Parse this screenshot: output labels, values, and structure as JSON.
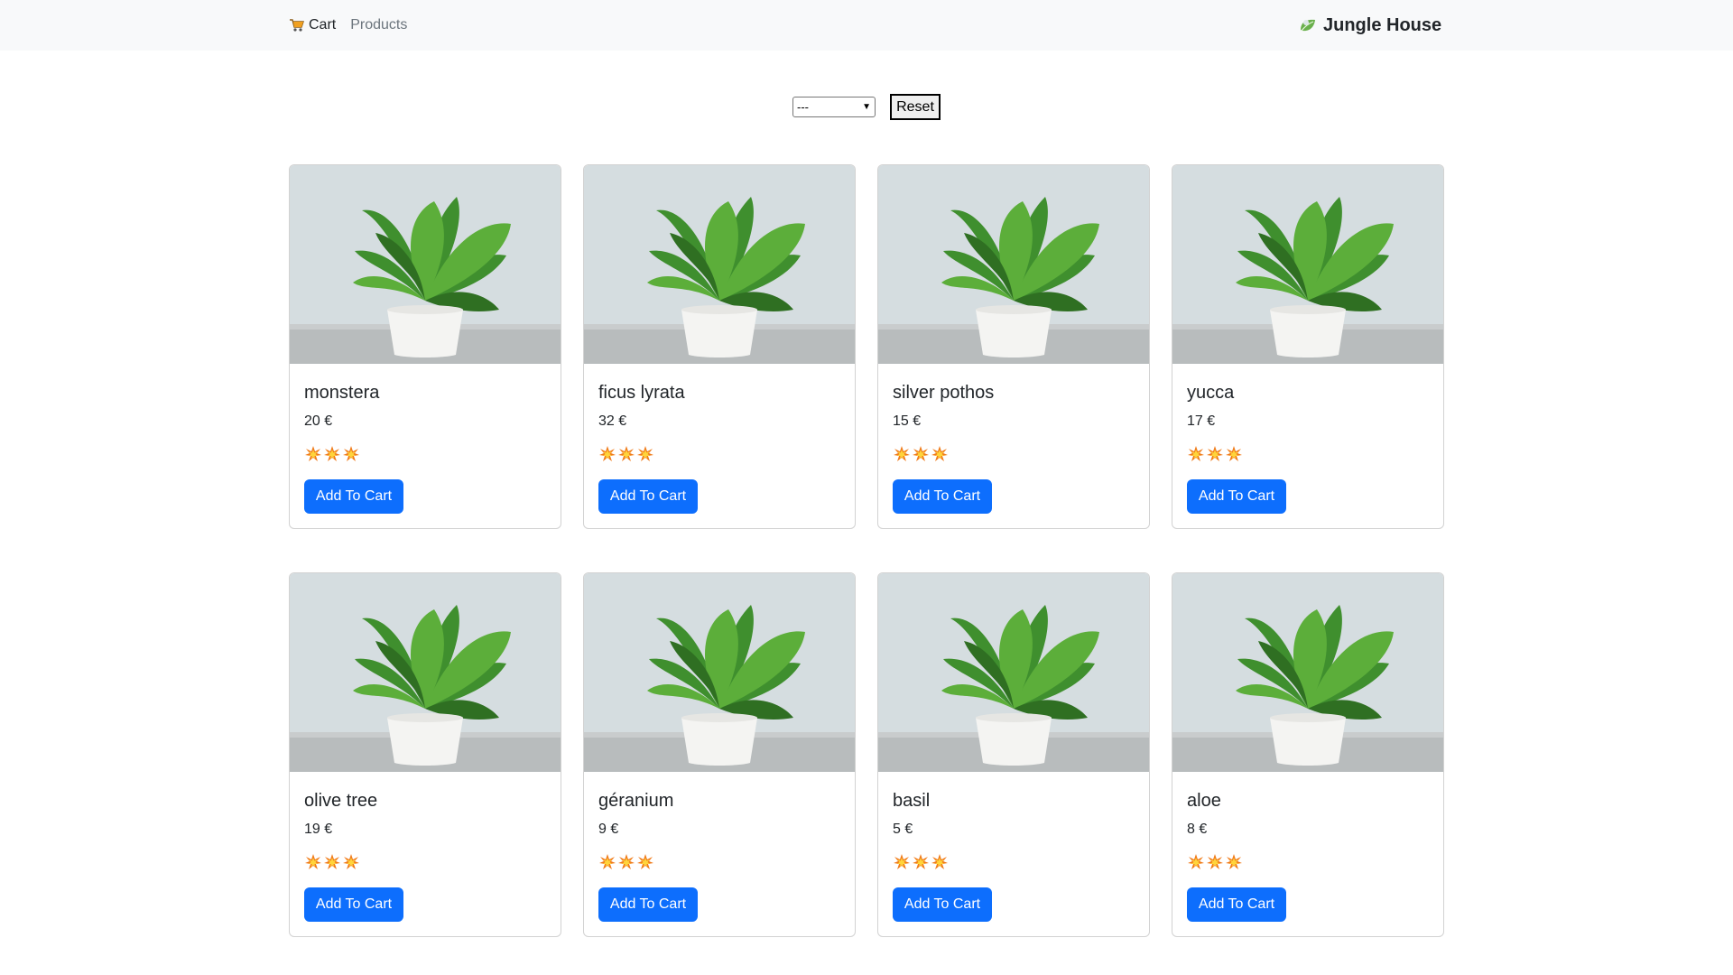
{
  "nav": {
    "cart_label": "Cart",
    "products_label": "Products",
    "brand": "Jungle House"
  },
  "filter": {
    "selected": "---",
    "reset_label": "Reset"
  },
  "products": [
    {
      "name": "monstera",
      "price": "20 €",
      "rating": 3,
      "button": "Add To Cart"
    },
    {
      "name": "ficus lyrata",
      "price": "32 €",
      "rating": 3,
      "button": "Add To Cart"
    },
    {
      "name": "silver pothos",
      "price": "15 €",
      "rating": 3,
      "button": "Add To Cart"
    },
    {
      "name": "yucca",
      "price": "17 €",
      "rating": 3,
      "button": "Add To Cart"
    },
    {
      "name": "olive tree",
      "price": "19 €",
      "rating": 3,
      "button": "Add To Cart"
    },
    {
      "name": "géranium",
      "price": "9 €",
      "rating": 3,
      "button": "Add To Cart"
    },
    {
      "name": "basil",
      "price": "5 €",
      "rating": 3,
      "button": "Add To Cart"
    },
    {
      "name": "aloe",
      "price": "8 €",
      "rating": 3,
      "button": "Add To Cart"
    }
  ],
  "icons": {
    "cart": "shopping-cart-icon",
    "brand": "leaf-logo-icon",
    "rating": "collision-burst-icon"
  },
  "colors": {
    "accent": "#0d6efd",
    "navbar_bg": "#f8f9fa"
  }
}
